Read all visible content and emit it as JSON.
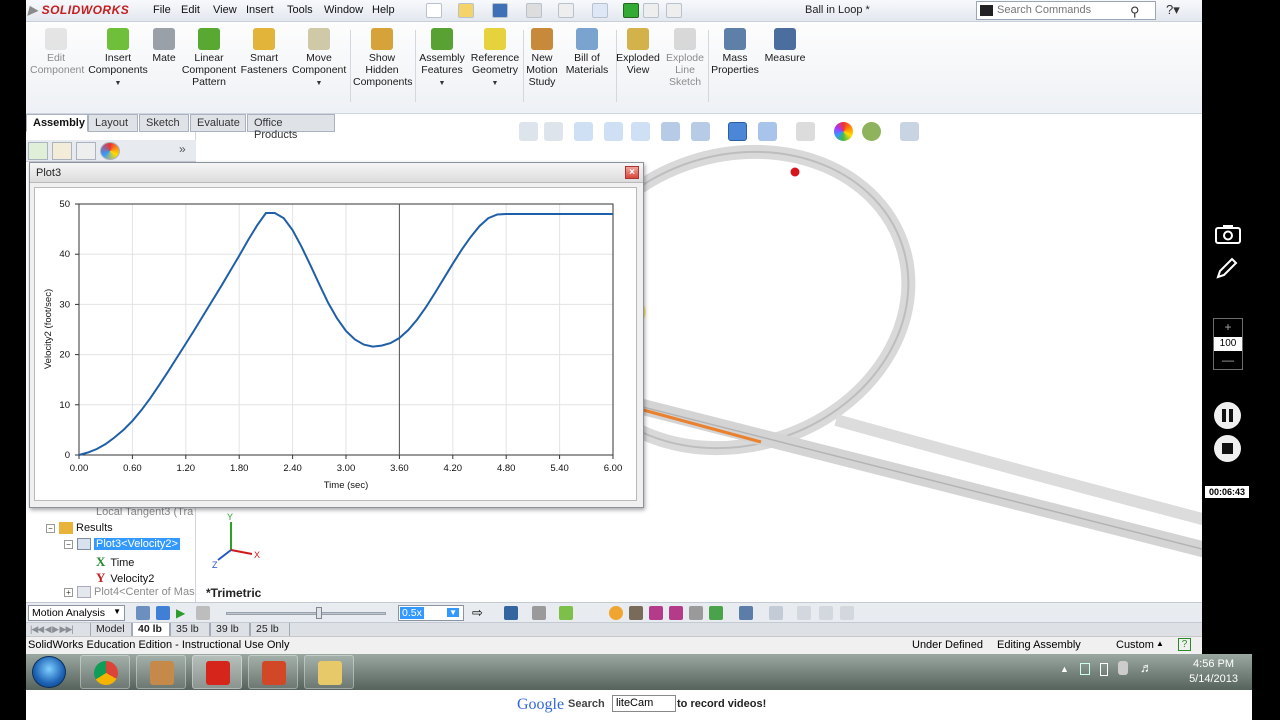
{
  "app": {
    "brand": "SOLIDWORKS",
    "document_title": "Ball in Loop *",
    "menus": [
      "File",
      "Edit",
      "View",
      "Insert",
      "Tools",
      "Window",
      "Help"
    ],
    "search_placeholder": "Search Commands"
  },
  "command_manager": {
    "items": [
      {
        "label": "Edit\nComponent",
        "icon": "edit-component-icon",
        "enabled": false
      },
      {
        "label": "Insert\nComponents",
        "icon": "insert-components-icon",
        "enabled": true
      },
      {
        "label": "Mate",
        "icon": "mate-icon",
        "enabled": true
      },
      {
        "label": "Linear\nComponent\nPattern",
        "icon": "linear-pattern-icon",
        "enabled": true
      },
      {
        "label": "Smart\nFasteners",
        "icon": "smart-fasteners-icon",
        "enabled": true
      },
      {
        "label": "Move\nComponent",
        "icon": "move-component-icon",
        "enabled": true
      },
      {
        "label": "Show\nHidden\nComponents",
        "icon": "show-hidden-icon",
        "enabled": true
      },
      {
        "label": "Assembly\nFeatures",
        "icon": "assembly-features-icon",
        "enabled": true
      },
      {
        "label": "Reference\nGeometry",
        "icon": "reference-geometry-icon",
        "enabled": true
      },
      {
        "label": "New\nMotion\nStudy",
        "icon": "new-motion-study-icon",
        "enabled": true
      },
      {
        "label": "Bill of\nMaterials",
        "icon": "bom-icon",
        "enabled": true
      },
      {
        "label": "Exploded\nView",
        "icon": "exploded-view-icon",
        "enabled": true
      },
      {
        "label": "Explode\nLine\nSketch",
        "icon": "explode-line-icon",
        "enabled": false
      },
      {
        "label": "Mass\nProperties",
        "icon": "mass-properties-icon",
        "enabled": true
      },
      {
        "label": "Measure",
        "icon": "measure-icon",
        "enabled": true
      }
    ],
    "tabs": [
      "Assembly",
      "Layout",
      "Sketch",
      "Evaluate",
      "Office Products"
    ]
  },
  "feature_tree": {
    "rows": [
      {
        "label": "Local Tangent3 (Tra",
        "muted": true
      },
      {
        "label": "Results",
        "muted": false
      },
      {
        "label": "Plot3<Velocity2>",
        "muted": false,
        "selected": true
      },
      {
        "label": "Time",
        "muted": false,
        "axis": "X"
      },
      {
        "label": "Velocity2",
        "muted": false,
        "axis": "Y"
      },
      {
        "label": "Plot4<Center of Mas",
        "muted": true
      }
    ]
  },
  "plot_window": {
    "title": "Plot3"
  },
  "chart_data": {
    "type": "line",
    "title": "",
    "xlabel": "Time (sec)",
    "ylabel": "Velocity2 (foot/sec)",
    "xlim": [
      0,
      6
    ],
    "ylim": [
      0,
      50
    ],
    "x_ticks": [
      "0.00",
      "0.60",
      "1.20",
      "1.80",
      "2.40",
      "3.00",
      "3.60",
      "4.20",
      "4.80",
      "5.40",
      "6.00"
    ],
    "y_ticks": [
      "0",
      "10",
      "20",
      "30",
      "40",
      "50"
    ],
    "grid": true,
    "cursor_x": 3.6,
    "series": [
      {
        "name": "",
        "color": "#1f5fa8",
        "x": [
          0.0,
          0.1,
          0.2,
          0.3,
          0.4,
          0.5,
          0.6,
          0.7,
          0.8,
          0.9,
          1.0,
          1.1,
          1.2,
          1.3,
          1.4,
          1.5,
          1.6,
          1.7,
          1.8,
          1.9,
          2.0,
          2.1,
          2.2,
          2.3,
          2.4,
          2.5,
          2.6,
          2.7,
          2.8,
          2.9,
          3.0,
          3.1,
          3.2,
          3.3,
          3.4,
          3.5,
          3.6,
          3.7,
          3.8,
          3.9,
          4.0,
          4.1,
          4.2,
          4.3,
          4.4,
          4.5,
          4.6,
          4.7,
          4.8,
          4.9,
          5.0,
          5.2,
          5.4,
          5.6,
          5.8,
          6.0
        ],
        "y": [
          0.0,
          0.5,
          1.2,
          2.2,
          3.5,
          5.0,
          6.8,
          8.9,
          11.3,
          13.9,
          16.6,
          19.4,
          22.2,
          25.0,
          27.9,
          30.8,
          33.7,
          36.7,
          39.7,
          42.8,
          45.7,
          48.2,
          48.2,
          47.2,
          44.8,
          41.5,
          37.8,
          34.0,
          30.3,
          27.2,
          24.7,
          23.0,
          22.0,
          21.6,
          21.8,
          22.3,
          23.3,
          24.9,
          27.0,
          29.5,
          32.3,
          35.2,
          38.1,
          40.9,
          43.4,
          45.6,
          47.2,
          47.9,
          48.0,
          48.0,
          48.0,
          48.0,
          48.0,
          48.0,
          48.0,
          48.0
        ]
      }
    ]
  },
  "view": {
    "orientation_label": "*Trimetric",
    "triad": [
      "Y",
      "X",
      "Z"
    ]
  },
  "motion_manager": {
    "study_type": "Motion Analysis",
    "playback_speed": "0.5x"
  },
  "configurations": [
    "Model",
    "40 lb",
    "35 lb",
    "39 lb",
    "25 lb"
  ],
  "status_bar": {
    "edition": "SolidWorks Education Edition - Instructional Use Only",
    "state": "Under Defined",
    "mode": "Editing Assembly",
    "units": "Custom"
  },
  "recorder": {
    "zoom": "100",
    "elapsed": "00:06:43"
  },
  "taskbar": {
    "time": "4:56 PM",
    "date": "5/14/2013"
  },
  "ad_bar": {
    "brand": "Google",
    "search_label": "Search",
    "input_value": "liteCam",
    "tail": "to record videos!"
  }
}
